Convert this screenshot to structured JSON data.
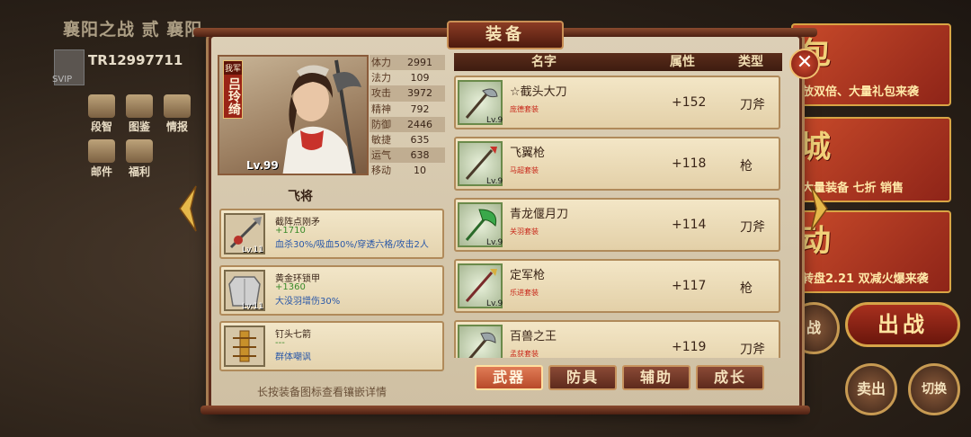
{
  "background": {
    "title": "襄阳之战 贰 襄阳",
    "player_id": "TR12997711",
    "vip": "SVIP",
    "menu": [
      "段智",
      "图鉴",
      "情报",
      "邮件",
      "福利"
    ],
    "banners": [
      {
        "big": "包",
        "small": "放双倍、大量礼包来袭"
      },
      {
        "big": "城",
        "small": "大量装备 七折 销售"
      },
      {
        "big": "动",
        "small": "转盘2.21 双减火爆来袭"
      }
    ],
    "chuzhan": "出战",
    "round_buttons": [
      "战",
      "卖出",
      "切换"
    ]
  },
  "modal": {
    "title": "装备",
    "close": "✕"
  },
  "hero": {
    "faction": "我军",
    "name": "吕玲绮",
    "level": "Lv.99",
    "title": "飞将",
    "stats": [
      {
        "k": "体力",
        "v": "2991"
      },
      {
        "k": "法力",
        "v": "109"
      },
      {
        "k": "攻击",
        "v": "3972"
      },
      {
        "k": "精神",
        "v": "792"
      },
      {
        "k": "防御",
        "v": "2446"
      },
      {
        "k": "敏捷",
        "v": "635"
      },
      {
        "k": "运气",
        "v": "638"
      },
      {
        "k": "移动",
        "v": "10"
      }
    ]
  },
  "skills": [
    {
      "name": "截阵点刚矛",
      "value": "+1710",
      "desc": "血杀30%/吸血50%/穿透六格/攻击2人",
      "lv": "Lv.11"
    },
    {
      "name": "黄金环锁甲",
      "value": "+1360",
      "desc": "大没羽增伤30%",
      "lv": "Lv.11"
    },
    {
      "name": "钉头七箭",
      "value": "---",
      "desc": "群体嘲讽",
      "lv": ""
    }
  ],
  "hint": "长按装备图标查看镶嵌详情",
  "list": {
    "headers": {
      "name": "名字",
      "attr": "属性",
      "type": "类型"
    },
    "items": [
      {
        "name": "☆截头大刀",
        "set": "庞德套装",
        "attr": "+152",
        "type": "刀斧",
        "lv": "Lv.9"
      },
      {
        "name": "飞翼枪",
        "set": "马超套装",
        "attr": "+118",
        "type": "枪",
        "lv": "Lv.9"
      },
      {
        "name": "青龙偃月刀",
        "set": "关羽套装",
        "attr": "+114",
        "type": "刀斧",
        "lv": "Lv.9"
      },
      {
        "name": "定军枪",
        "set": "乐进套装",
        "attr": "+117",
        "type": "枪",
        "lv": "Lv.9"
      },
      {
        "name": "百兽之王",
        "set": "孟获套装",
        "attr": "+119",
        "type": "刀斧",
        "lv": ""
      }
    ]
  },
  "tabs": [
    "武器",
    "防具",
    "辅助",
    "成长"
  ],
  "colors": {
    "accent": "#b84a2a",
    "frame": "#5e2c1c",
    "panel": "#dccfb6"
  }
}
